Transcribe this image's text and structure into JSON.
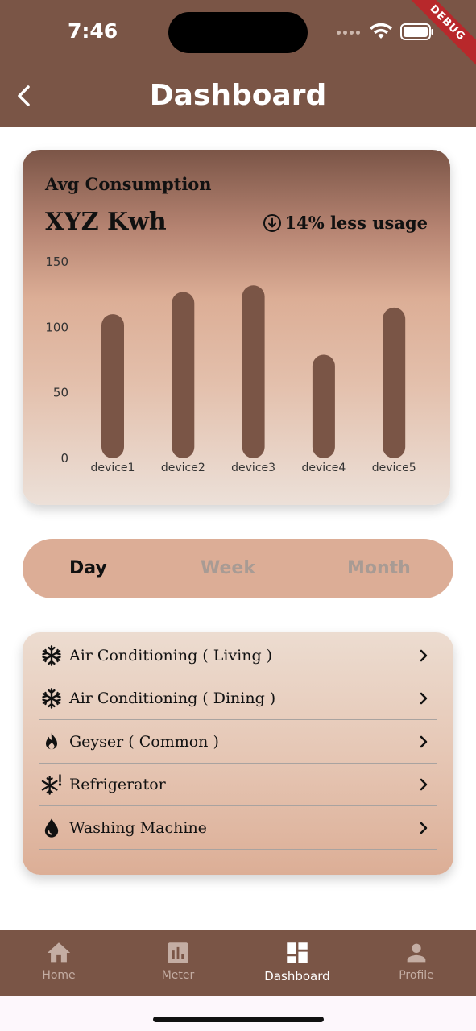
{
  "status_bar": {
    "time": "7:46",
    "debug_label": "DEBUG"
  },
  "app_bar": {
    "title": "Dashboard",
    "back_icon": "chevron-left-icon"
  },
  "consumption_card": {
    "label": "Avg Consumption",
    "value": "XYZ Kwh",
    "usage_text": "14% less usage",
    "usage_icon": "arrow-down-circle-icon"
  },
  "chart_data": {
    "type": "bar",
    "categories": [
      "device1",
      "device2",
      "device3",
      "device4",
      "device5"
    ],
    "values": [
      110,
      127,
      132,
      79,
      115
    ],
    "ylim": [
      0,
      150
    ],
    "yticks": [
      0,
      50,
      100,
      150
    ],
    "bar_color": "#7a5546",
    "grid": false,
    "title": "",
    "xlabel": "",
    "ylabel": ""
  },
  "period_selector": {
    "options": [
      "Day",
      "Week",
      "Month"
    ],
    "selected": "Day"
  },
  "devices": [
    {
      "label": "Air Conditioning ( Living )",
      "icon": "snowflake-icon"
    },
    {
      "label": "Air Conditioning ( Dining )",
      "icon": "snowflake-icon"
    },
    {
      "label": "Geyser ( Common )",
      "icon": "flame-icon"
    },
    {
      "label": "Refrigerator",
      "icon": "snowflake-alert-icon"
    },
    {
      "label": "Washing Machine",
      "icon": "water-drop-icon"
    }
  ],
  "bottom_nav": {
    "items": [
      {
        "label": "Home",
        "icon": "home-icon"
      },
      {
        "label": "Meter",
        "icon": "bar-chart-icon"
      },
      {
        "label": "Dashboard",
        "icon": "dashboard-icon"
      },
      {
        "label": "Profile",
        "icon": "person-icon"
      }
    ],
    "active": "Dashboard"
  },
  "colors": {
    "primary": "#7a5546",
    "accent": "#dcad96",
    "inactive_text": "#a89b94"
  }
}
